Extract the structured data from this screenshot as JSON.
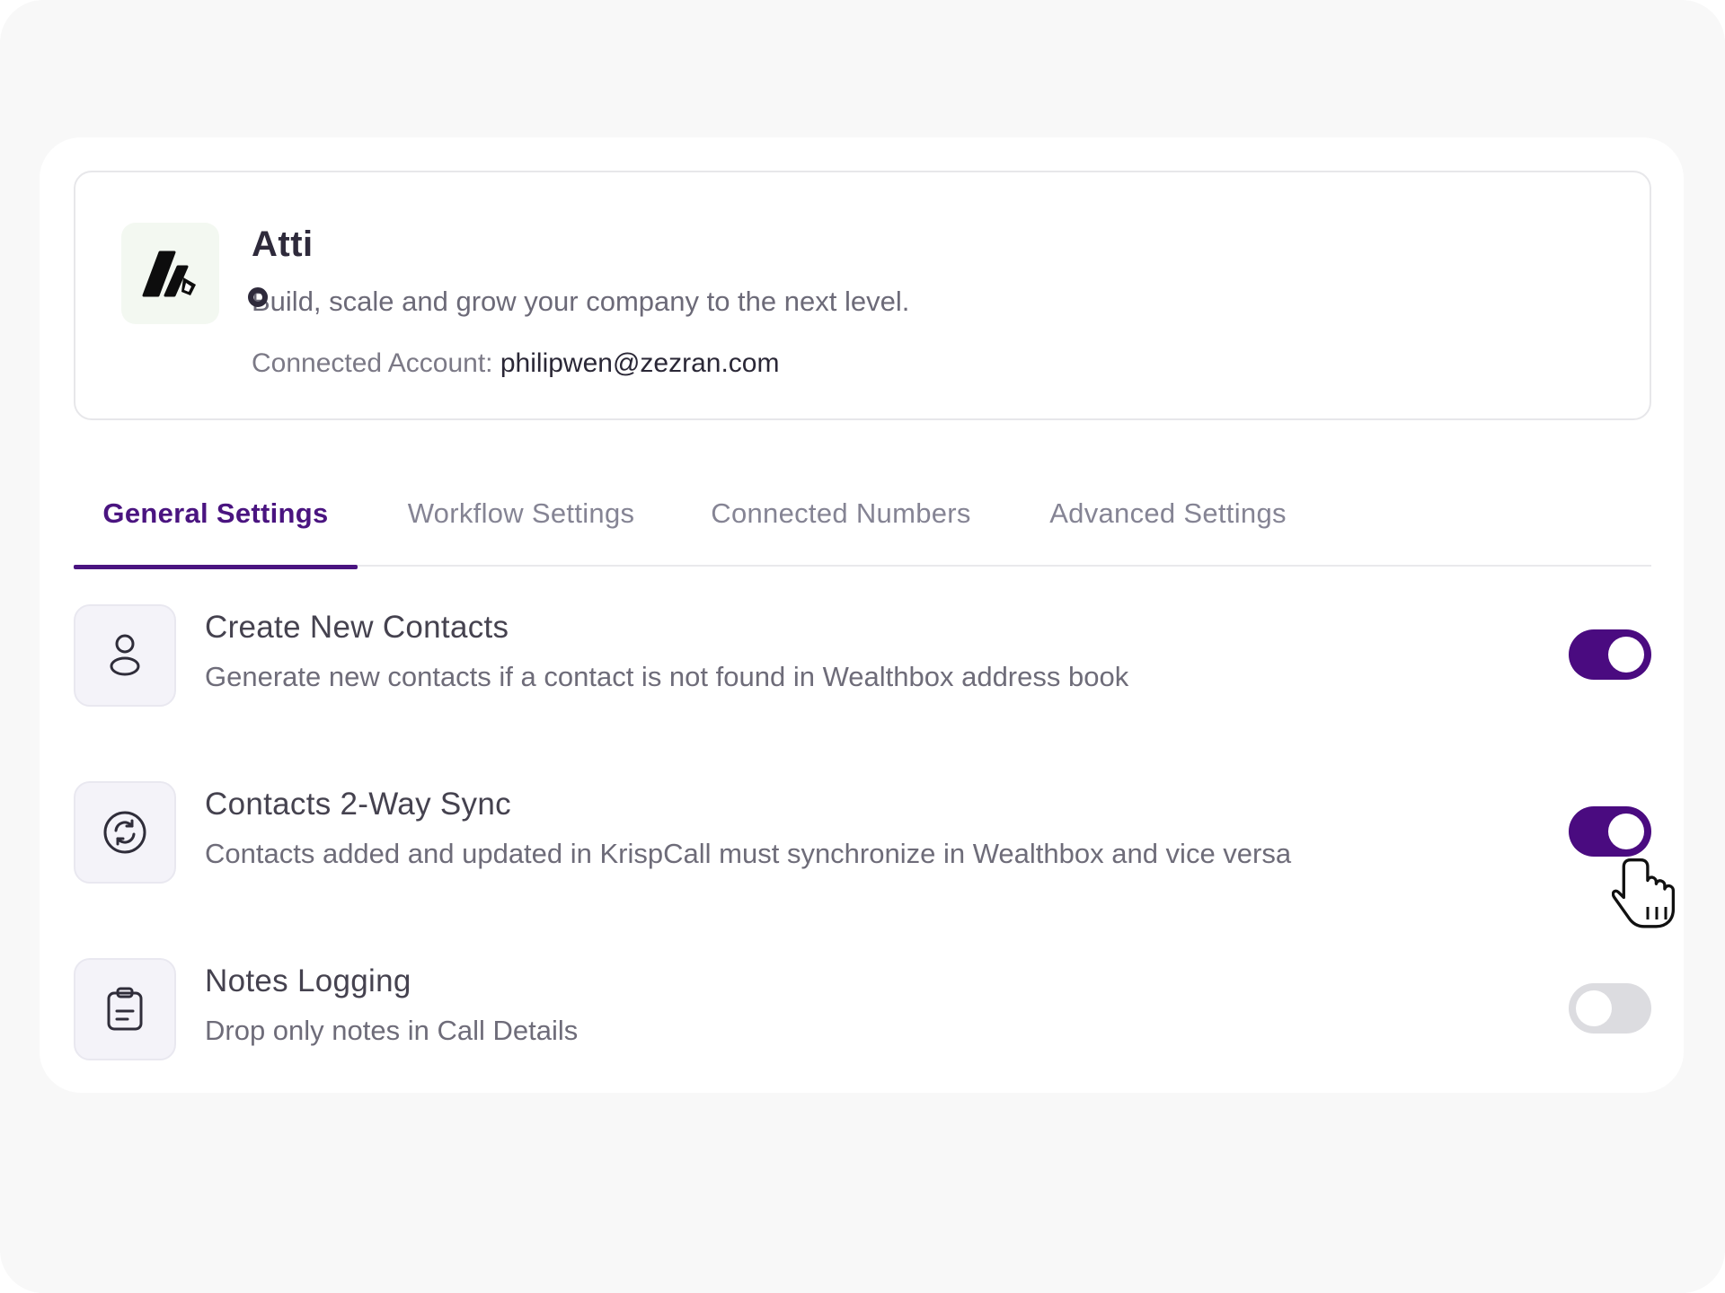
{
  "app": {
    "name": "Atti",
    "tagline": "Build, scale and grow your company to the next level.",
    "account_label": "Connected Account:",
    "account_email": "philipwen@zezran.com",
    "logo_icon": "attio-logo-icon"
  },
  "tabs": [
    {
      "label": "General Settings",
      "active": true
    },
    {
      "label": "Workflow Settings",
      "active": false
    },
    {
      "label": "Connected Numbers",
      "active": false
    },
    {
      "label": "Advanced Settings",
      "active": false
    }
  ],
  "settings": [
    {
      "title": "Create New Contacts",
      "description": "Generate new contacts if a contact is not found in Wealthbox address book",
      "icon": "user-icon",
      "enabled": true
    },
    {
      "title": "Contacts 2-Way Sync",
      "description": "Contacts added and updated in KrispCall must synchronize in Wealthbox and vice versa",
      "icon": "sync-icon",
      "enabled": true
    },
    {
      "title": "Notes Logging",
      "description": "Drop only notes in Call Details",
      "icon": "clipboard-icon",
      "enabled": false
    }
  ],
  "colors": {
    "accent": "#4a0b80",
    "toggle_off": "#dcdce0",
    "tab_active": "#4a1480"
  }
}
